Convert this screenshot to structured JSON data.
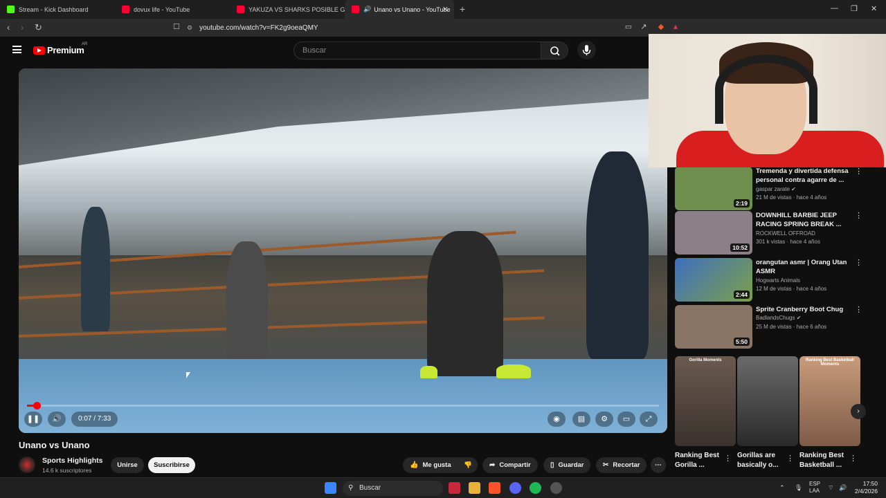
{
  "browser": {
    "tabs": [
      {
        "label": "Stream - Kick Dashboard",
        "color": "#53fc18"
      },
      {
        "label": "dovux life - YouTube",
        "color": "#ff0033"
      },
      {
        "label": "YAKUZA VS SHARKS POSIBLE GUERR",
        "color": "#ff0033"
      },
      {
        "label": "Unano vs Unano - YouTube",
        "color": "#ff0033",
        "active": true
      }
    ],
    "url": "youtube.com/watch?v=FK2g9oeaQMY"
  },
  "header": {
    "logo": "Premium",
    "region": "AR",
    "search_placeholder": "Buscar"
  },
  "player": {
    "time": "0:07 / 7:33",
    "progress": 0.0155
  },
  "video": {
    "title": "Unano vs Unano",
    "channel": "Sports Highlights",
    "subscribers": "14.6 k suscriptores",
    "join": "Unirse",
    "subscribe": "Suscribirse",
    "actions": {
      "like": "Me gusta",
      "share": "Compartir",
      "save": "Guardar",
      "clip": "Recortar"
    }
  },
  "recommendations": [
    {
      "title": "Tremenda y divertida defensa personal contra agarre de ...",
      "channel": "gaspar zarate",
      "meta": "21 M de vistas · hace 4 años",
      "duration": "2:19",
      "verified": true,
      "thumb": "#6f8f4e"
    },
    {
      "title": "DOWNHILL BARBIE JEEP RACING SPRING BREAK ...",
      "channel": "ROCKWELL OFFROAD",
      "meta": "301 k vistas · hace 4 años",
      "duration": "10:52",
      "verified": false,
      "thumb": "#8a7f86"
    },
    {
      "title": "orangutan asmr | Orang Utan ASMR",
      "channel": "Hogwarts Animals",
      "meta": "12 M de vistas · hace 4 años",
      "duration": "2:44",
      "verified": false,
      "thumb": "#3d6fbf"
    },
    {
      "title": "Sprite Cranberry Boot Chug",
      "channel": "BadlandsChugs",
      "meta": "25 M de vistas · hace 6 años",
      "duration": "5:50",
      "verified": true,
      "thumb": "#8a7466"
    }
  ],
  "shorts": [
    {
      "title": "Ranking Best Gorilla ...",
      "caption": "Gorilla Moments",
      "thumb": "#6b5a4f"
    },
    {
      "title": "Gorillas are basically o...",
      "caption": "",
      "thumb": "#3b3b3b"
    },
    {
      "title": "Ranking Best Basketball ...",
      "caption": "Ranking Best Basketball Moments",
      "thumb": "#a8745c"
    }
  ],
  "taskbar": {
    "search": "Buscar",
    "lang1": "ESP",
    "lang2": "LAA",
    "time": "17:50",
    "date": "2/4/2026"
  }
}
